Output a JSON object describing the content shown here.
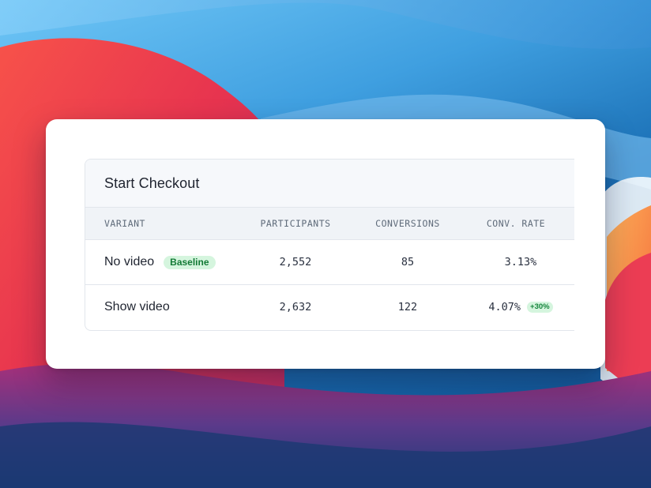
{
  "wallpaper": {
    "name": "abstract macOS-style wallpaper",
    "colors": {
      "sky": "#5bb6ef",
      "deep_blue": "#0e4f8f",
      "red": "#e93a4f",
      "magenta": "#c2305e",
      "orange": "#f59a3c",
      "navy": "#1d3566"
    }
  },
  "panel": {
    "title": "Start Checkout"
  },
  "table": {
    "columns": [
      "VARIANT",
      "PARTICIPANTS",
      "CONVERSIONS",
      "CONV. RATE"
    ],
    "rows": [
      {
        "variant": "No video",
        "badge": "Baseline",
        "participants": "2,552",
        "conversions": "85",
        "conv_rate": "3.13%",
        "lift": null
      },
      {
        "variant": "Show video",
        "badge": null,
        "participants": "2,632",
        "conversions": "122",
        "conv_rate": "4.07%",
        "lift": "+30%"
      }
    ]
  },
  "colors": {
    "badge_bg": "#d5f5de",
    "badge_text": "#137a36",
    "header_bg": "#f6f8fb",
    "border": "#e2e6ec"
  }
}
